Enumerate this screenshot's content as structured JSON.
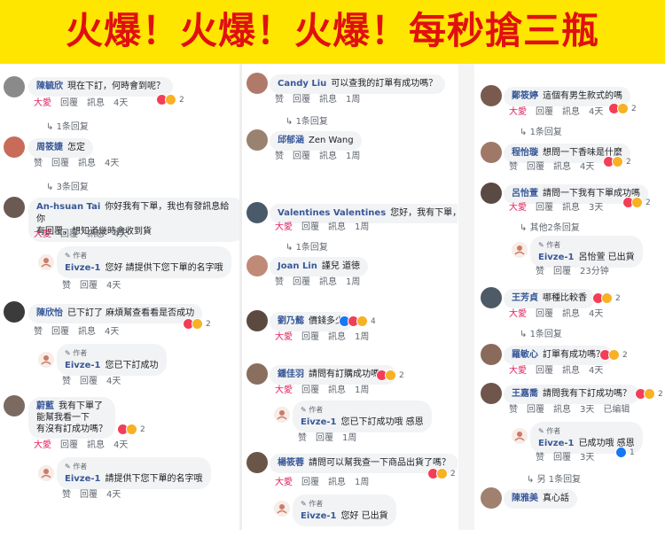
{
  "banner": {
    "text": "火爆！火爆！火爆！每秒搶三瓶"
  },
  "colors": {
    "banner_bg": "#ffe600",
    "banner_text": "#e01010",
    "author": "#385898",
    "love": "#e0245e"
  },
  "col1": {
    "c1": {
      "author": "陳毓欣",
      "text": "現在下訂，何時會到呢？",
      "a1": "大愛",
      "a2": "回覆",
      "a3": "訊息",
      "a4": "4天",
      "count": "2",
      "replies": "1条回复"
    },
    "c2": {
      "author": "周筱婕",
      "text": "怎定",
      "a1": "赞",
      "a2": "回覆",
      "a3": "訊息",
      "a4": "4天",
      "replies": "3条回复"
    },
    "c3": {
      "author": "An-hsuan Tai",
      "line1": "你好我有下單，我也有發訊息給你",
      "line2": "有回覆，想知道幾時會收到貨",
      "a1": "大愛",
      "a2": "回覆",
      "a3": "訊息",
      "a4": "4天"
    },
    "r1": {
      "tag": "作者",
      "author": "Eivze-1",
      "text": "您好 請提供下您下單的名字哦",
      "a1": "赞",
      "a2": "回覆",
      "a3": "4天"
    },
    "c4": {
      "author": "陳欣怡",
      "text": "已下訂了 麻煩幫查看看是否成功",
      "count": "2",
      "a1": "赞",
      "a2": "回覆",
      "a3": "訊息",
      "a4": "4天"
    },
    "r2": {
      "tag": "作者",
      "author": "Eivze-1",
      "text": "您已下訂成功",
      "a1": "赞",
      "a2": "回覆",
      "a3": "4天"
    },
    "c5": {
      "author": "蔚藍",
      "line1": "我有下單了",
      "line2": "能幫我看一下",
      "line3": "有沒有訂成功嗎？",
      "count": "2",
      "a1": "大愛",
      "a2": "回覆",
      "a3": "訊息",
      "a4": "4天"
    },
    "r3": {
      "tag": "作者",
      "author": "Eivze-1",
      "text": "請提供下您下單的名字哦",
      "a1": "赞",
      "a2": "回覆",
      "a3": "4天"
    }
  },
  "col2": {
    "c1": {
      "author": "Candy Liu",
      "text": "可以查我的訂單有成功嗎？",
      "a1": "赞",
      "a2": "回覆",
      "a3": "訊息",
      "a4": "1周",
      "replies": "1条回复"
    },
    "c2": {
      "author": "邱郁涵",
      "text": "Zen Wang",
      "a1": "赞",
      "a2": "回覆",
      "a3": "訊息",
      "a4": "1周"
    },
    "c3": {
      "author": "Valentines Valentines",
      "text": "您好，我有下單，下單",
      "a1": "大愛",
      "a2": "回覆",
      "a3": "訊息",
      "a4": "1周",
      "replies": "1条回复"
    },
    "c4": {
      "author": "Joan Lin",
      "text": "謹兒 道徳",
      "a1": "赞",
      "a2": "回覆",
      "a3": "訊息",
      "a4": "1周"
    },
    "c5": {
      "author": "劉乃懿",
      "text": "價錢多少",
      "count": "4",
      "a1": "大愛",
      "a2": "回覆",
      "a3": "訊息",
      "a4": "1周"
    },
    "c6": {
      "author": "鍾佳羽",
      "text": "請問有訂購成功嗎？",
      "count": "2",
      "a1": "大愛",
      "a2": "回覆",
      "a3": "訊息",
      "a4": "1周"
    },
    "r1": {
      "tag": "作者",
      "author": "Eivze-1",
      "text": "您已下訂成功哦 感恩",
      "a1": "赞",
      "a2": "回覆",
      "a3": "1周"
    },
    "c7": {
      "author": "楊筱蓉",
      "text": "請問可以幫我查一下商品出貨了嗎？",
      "count": "2",
      "a1": "大愛",
      "a2": "回覆",
      "a3": "訊息",
      "a4": "1周"
    },
    "r2": {
      "tag": "作者",
      "author": "Eivze-1",
      "text": "您好 已出貨"
    }
  },
  "col3": {
    "c1": {
      "author": "鄭筱婷",
      "text": "這個有男生款式的嗎",
      "count": "2",
      "a1": "大愛",
      "a2": "回覆",
      "a3": "訊息",
      "a4": "4天",
      "replies": "1条回复"
    },
    "c2": {
      "author": "程怡璇",
      "text": "想問一下香味是什麼",
      "count": "2",
      "a1": "赞",
      "a2": "回覆",
      "a3": "訊息",
      "a4": "4天"
    },
    "c3": {
      "author": "呂怡萱",
      "text": "請問一下我有下單成功嗎",
      "count": "2",
      "a1": "大愛",
      "a2": "回覆",
      "a3": "訊息",
      "a4": "3天",
      "replies": "其他2条回复"
    },
    "r1": {
      "tag": "作者",
      "author": "Eivze-1",
      "text": "呂怡萱 已出貨",
      "a1": "赞",
      "a2": "回覆",
      "a3": "23分钟"
    },
    "c4": {
      "author": "王芳貞",
      "text": "哪種比較香",
      "count": "2",
      "a1": "大愛",
      "a2": "回覆",
      "a3": "訊息",
      "a4": "4天",
      "replies": "1条回复"
    },
    "c5": {
      "author": "羅敏心",
      "text": "訂單有成功嗎？",
      "count": "2",
      "a1": "大愛",
      "a2": "回覆",
      "a3": "訊息",
      "a4": "4天"
    },
    "c6": {
      "author": "王嘉喬",
      "text": "請問我有下訂成功嗎？",
      "count": "2",
      "a1": "赞",
      "a2": "回覆",
      "a3": "訊息",
      "a4": "3天",
      "a5": "已编辑"
    },
    "r2": {
      "tag": "作者",
      "author": "Eivze-1",
      "text": "已成功哦 感恩",
      "a1": "赞",
      "a2": "回覆",
      "a3": "3天",
      "count": "1"
    },
    "r3": {
      "replies": "另 1条回复"
    },
    "c7": {
      "author": "陳雅美",
      "text": "真心話"
    }
  }
}
